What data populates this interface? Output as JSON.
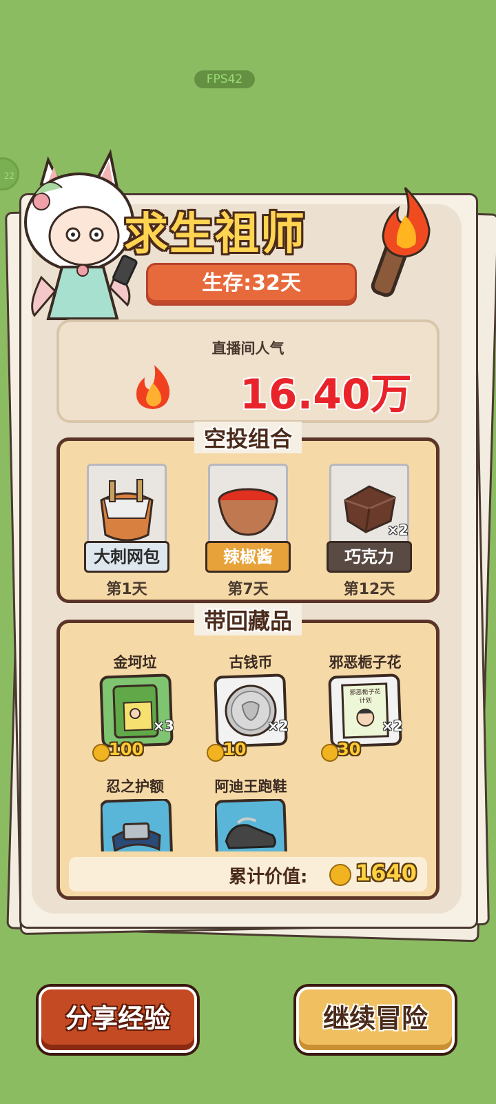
{
  "hud": {
    "fps": "FPS42",
    "side_badge": "22"
  },
  "header": {
    "title": "求生祖师",
    "survival": "生存:32天"
  },
  "popularity": {
    "label": "直播间人气",
    "value": "16.40万"
  },
  "airdrop": {
    "title": "空投组合",
    "items": [
      {
        "name": "大刺网包",
        "day": "第1天",
        "count": "",
        "label_bg": "#dfe7ee",
        "label_color": "#2a2a2a"
      },
      {
        "name": "辣椒酱",
        "day": "第7天",
        "count": "",
        "label_bg": "#e8a23a",
        "label_color": "#ffffff"
      },
      {
        "name": "巧克力",
        "day": "第12天",
        "count": "×2",
        "label_bg": "#5a4a44",
        "label_color": "#ffffff"
      }
    ]
  },
  "collection": {
    "title": "带回藏品",
    "items": [
      {
        "name": "金坷垃",
        "count": "×3",
        "value": "100"
      },
      {
        "name": "古钱币",
        "count": "×2",
        "value": "10"
      },
      {
        "name": "邪恶栀子花",
        "count": "×2",
        "value": "30",
        "card_text_1": "邪恶栀子花",
        "card_text_2": "计划"
      },
      {
        "name": "忍之护额",
        "count": "",
        "value": ""
      },
      {
        "name": "阿迪王跑鞋",
        "count": "",
        "value": ""
      }
    ],
    "total_label": "累计价值:",
    "total_value": "1640"
  },
  "buttons": {
    "share": "分享经验",
    "continue": "继续冒险"
  }
}
